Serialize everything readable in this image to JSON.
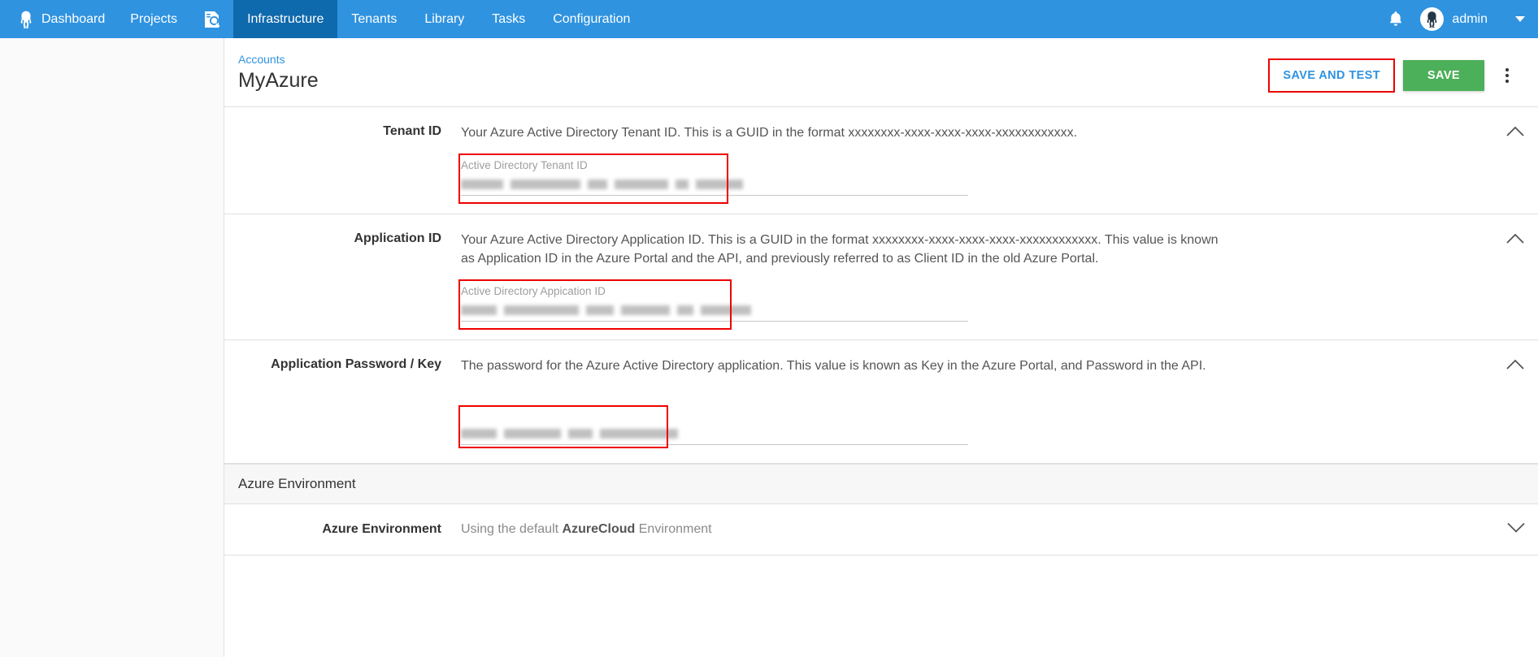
{
  "nav": {
    "logo_icon": "octopus-logo-icon",
    "items": [
      {
        "label": "Dashboard",
        "active": false
      },
      {
        "label": "Projects",
        "active": false
      },
      {
        "label": "Infrastructure",
        "active": true
      },
      {
        "label": "Tenants",
        "active": false
      },
      {
        "label": "Library",
        "active": false
      },
      {
        "label": "Tasks",
        "active": false
      },
      {
        "label": "Configuration",
        "active": false
      }
    ],
    "search_icon": "search-document-icon",
    "bell_icon": "notification-bell-icon",
    "user": "admin",
    "user_caret_icon": "chevron-down-icon",
    "bg_color": "#2f93e0",
    "active_bg_color": "#0f69ad"
  },
  "header": {
    "breadcrumb": "Accounts",
    "title": "MyAzure",
    "save_and_test_label": "SAVE AND TEST",
    "save_label": "SAVE",
    "overflow_icon": "vertical-dots-icon",
    "save_color": "#4caf59",
    "link_color": "#2f93e0",
    "highlight_color": "#ee0000"
  },
  "sections": [
    {
      "label": "Tenant ID",
      "description": "Your Azure Active Directory Tenant ID. This is a GUID in the format xxxxxxxx-xxxx-xxxx-xxxx-xxxxxxxxxxxx.",
      "field_label": "Active Directory Tenant ID",
      "field_value_redacted": true,
      "chevron_icon": "chevron-up-icon"
    },
    {
      "label": "Application ID",
      "description": "Your Azure Active Directory Application ID. This is a GUID in the format xxxxxxxx-xxxx-xxxx-xxxx-xxxxxxxxxxxx. This value is known as Application ID in the Azure Portal and the API, and previously referred to as Client ID in the old Azure Portal.",
      "field_label": "Active Directory Appication ID",
      "field_value_redacted": true,
      "chevron_icon": "chevron-up-icon"
    },
    {
      "label": "Application Password / Key",
      "description": "The password for the Azure Active Directory application. This value is known as Key in the Azure Portal, and Password in the API.",
      "field_label": "",
      "field_value_redacted": true,
      "chevron_icon": "chevron-up-icon"
    }
  ],
  "group": {
    "title": "Azure Environment",
    "row": {
      "label": "Azure Environment",
      "value_prefix": "Using the default ",
      "value_strong": "AzureCloud",
      "value_suffix": " Environment",
      "chevron_icon": "chevron-down-icon"
    }
  }
}
